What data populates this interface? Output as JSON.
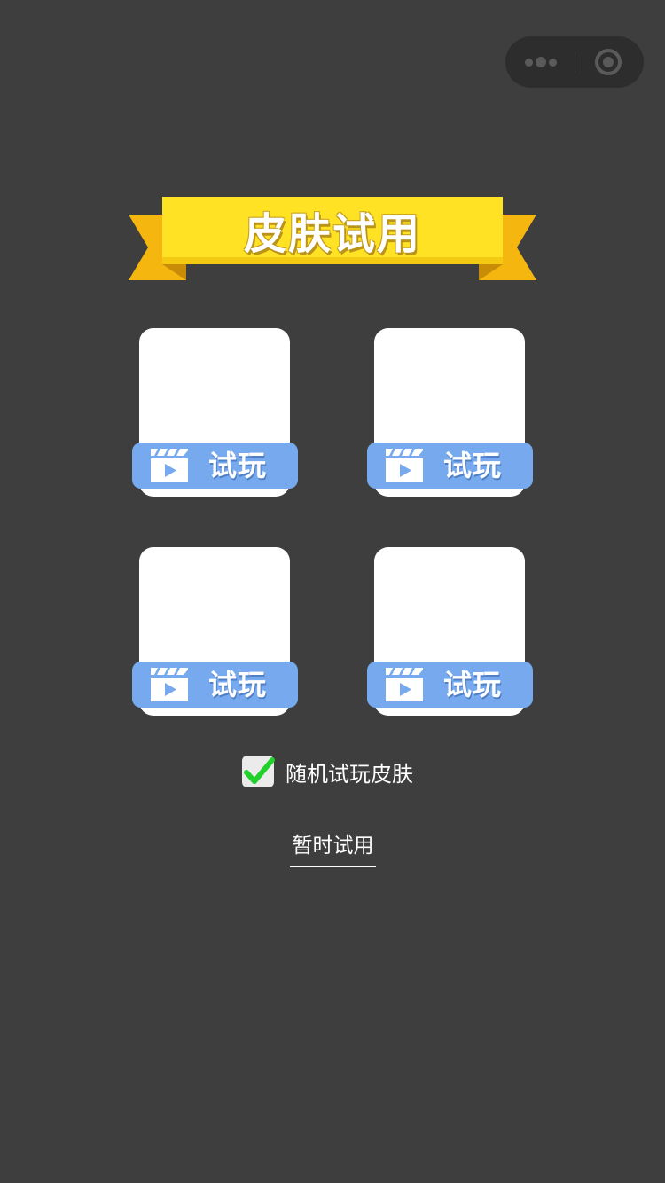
{
  "header": {
    "capsule_more_icon": "more-dots-icon",
    "capsule_close_icon": "target-close-icon"
  },
  "banner": {
    "title": "皮肤试用",
    "ribbon_color": "#ffe224",
    "ribbon_tail_color": "#f5b70f"
  },
  "skins": [
    {
      "trial_label": "试玩",
      "icon": "clapperboard-play-icon"
    },
    {
      "trial_label": "试玩",
      "icon": "clapperboard-play-icon"
    },
    {
      "trial_label": "试玩",
      "icon": "clapperboard-play-icon"
    },
    {
      "trial_label": "试玩",
      "icon": "clapperboard-play-icon"
    }
  ],
  "random_option": {
    "label": "随机试玩皮肤",
    "checked": true,
    "check_color": "#1fd12a"
  },
  "temp_button": {
    "label": "暂时试用"
  },
  "colors": {
    "background": "#3e3e3e",
    "trial_button": "#76a9ee",
    "card": "#ffffff"
  }
}
